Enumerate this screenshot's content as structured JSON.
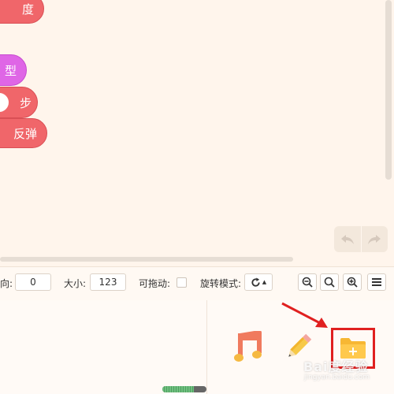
{
  "stage": {
    "blocks": [
      {
        "label": "度"
      },
      {
        "label": "型"
      },
      {
        "label": "步"
      },
      {
        "label": "反弹"
      }
    ]
  },
  "toolbar": {
    "undo_icon": "undo-icon",
    "redo_icon": "redo-icon"
  },
  "properties": {
    "direction_label": "向:",
    "direction_value": "0",
    "size_label": "大小:",
    "size_value": "123",
    "draggable_label": "可拖动:",
    "rotation_label": "旋转模式:",
    "rotation_icon": "rotate-icon"
  },
  "zoom": {
    "zoom_out_icon": "zoom-out-icon",
    "zoom_reset_icon": "zoom-reset-icon",
    "zoom_in_icon": "zoom-in-icon",
    "menu_icon": "menu-icon"
  },
  "assets": {
    "music_icon": "music-note-icon",
    "paint_icon": "pencil-icon",
    "upload_icon": "folder-add-icon"
  },
  "progress": {
    "value": 0.72
  },
  "watermark": {
    "text": "Bai度经验",
    "sub": "jingyan.baidu.com"
  },
  "colors": {
    "block_red": "#f0666a",
    "block_purple": "#df66e6",
    "highlight": "#e02020",
    "stage_bg": "#fff5ec"
  }
}
